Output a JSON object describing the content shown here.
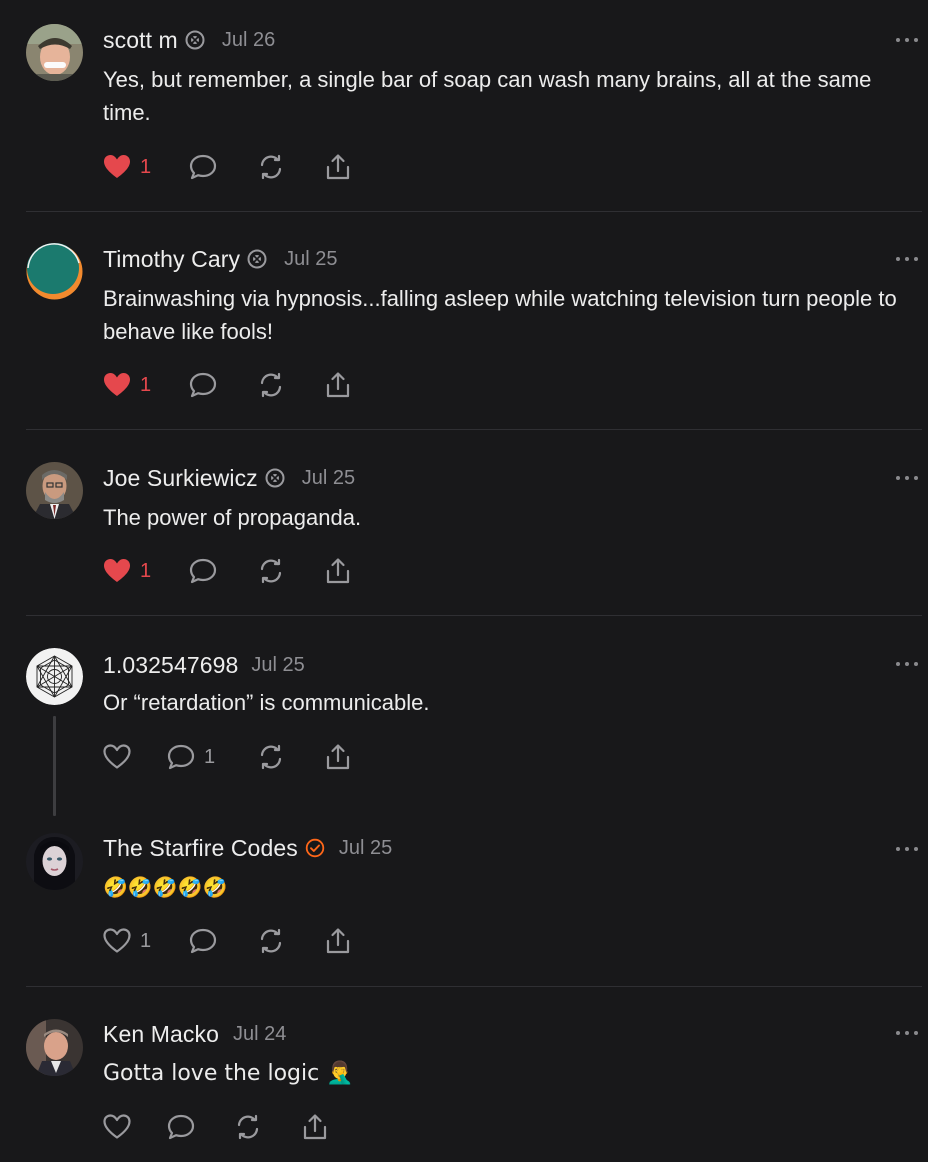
{
  "colors": {
    "background": "#18181a",
    "like_active": "#e5484d",
    "muted": "#8e8e93",
    "verified_orange": "#ff6719"
  },
  "comments": [
    {
      "author": "scott m",
      "badge": "subscriber-badge-icon",
      "date": "Jul 26",
      "text": "Yes, but remember, a single bar of soap can wash many brains, all at the same time.",
      "liked": true,
      "like_count": "1",
      "reply_count": ""
    },
    {
      "author": "Timothy Cary",
      "badge": "subscriber-badge-icon",
      "date": "Jul 25",
      "text": "Brainwashing via hypnosis...falling asleep while watching television turn people to behave like fools!",
      "liked": true,
      "like_count": "1",
      "reply_count": ""
    },
    {
      "author": "Joe Surkiewicz",
      "badge": "subscriber-badge-icon",
      "date": "Jul 25",
      "text": "The power of propaganda.",
      "liked": true,
      "like_count": "1",
      "reply_count": ""
    },
    {
      "author": "1.032547698",
      "badge": "",
      "date": "Jul 25",
      "text": "Or “retardation” is communicable.",
      "liked": false,
      "like_count": "",
      "reply_count": "1"
    },
    {
      "author": "The Starfire Codes",
      "badge": "verified-check-icon",
      "date": "Jul 25",
      "text": "🤣🤣🤣🤣🤣",
      "liked": false,
      "like_count": "1",
      "reply_count": ""
    },
    {
      "author": "Ken Macko",
      "badge": "",
      "date": "Jul 24",
      "text": "Gotta love the logic 🤦‍♂️",
      "liked": false,
      "like_count": "",
      "reply_count": ""
    }
  ]
}
